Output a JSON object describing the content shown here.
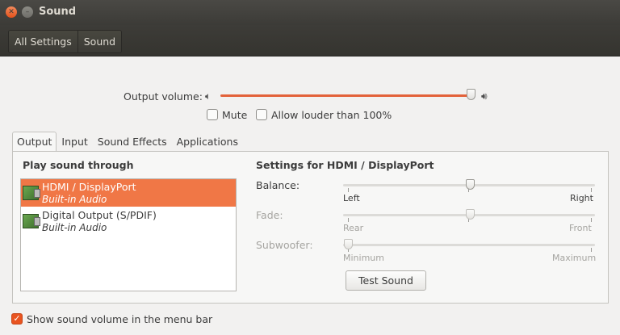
{
  "window": {
    "title": "Sound",
    "close_icon": "close-icon",
    "minimize_icon": "minimize-icon"
  },
  "toolbar": {
    "all_settings": "All Settings",
    "current": "Sound"
  },
  "output_volume": {
    "label": "Output volume:",
    "level_percent": 99,
    "mute_label": "Mute",
    "mute_checked": false,
    "louder_label": "Allow louder than 100%",
    "louder_checked": false
  },
  "tabs": [
    "Output",
    "Input",
    "Sound Effects",
    "Applications"
  ],
  "active_tab": "Output",
  "output": {
    "play_through_title": "Play sound through",
    "devices": [
      {
        "name": "HDMI / DisplayPort",
        "subtitle": "Built-in Audio",
        "selected": true
      },
      {
        "name": "Digital Output (S/PDIF)",
        "subtitle": "Built-in Audio",
        "selected": false
      }
    ],
    "settings_title": "Settings for HDMI / DisplayPort",
    "balance": {
      "label": "Balance:",
      "left": "Left",
      "right": "Right",
      "value": 0.5
    },
    "fade": {
      "label": "Fade:",
      "left": "Rear",
      "right": "Front",
      "value": 0.5
    },
    "subwoofer": {
      "label": "Subwoofer:",
      "left": "Minimum",
      "right": "Maximum",
      "value": 0.0
    },
    "test_sound_label": "Test Sound"
  },
  "footer": {
    "show_in_menu_label": "Show sound volume in the menu bar",
    "show_in_menu_checked": true
  },
  "colors": {
    "accent": "#e95420",
    "selection": "#f07746",
    "titlebar": "#3c3b37"
  }
}
